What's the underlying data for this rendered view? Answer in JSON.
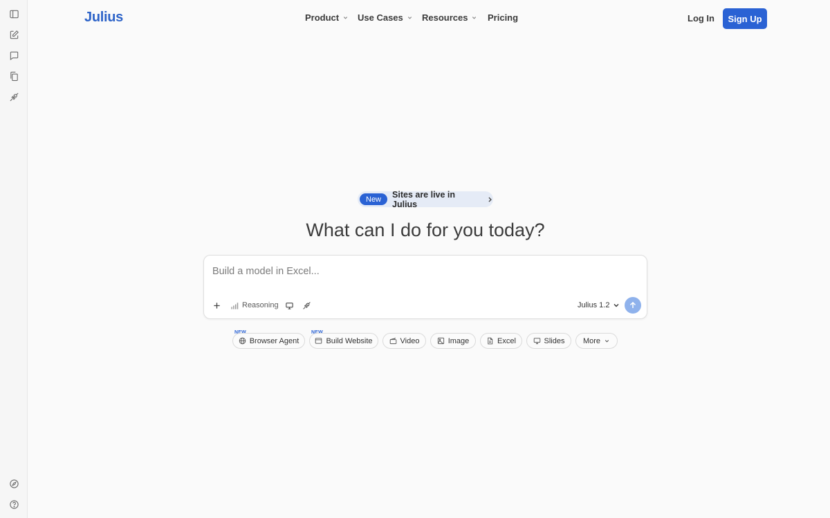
{
  "brand": {
    "logo": "Julius",
    "color": "#2d63c8"
  },
  "sidebar": {
    "top_icons": [
      "sidebar-toggle-icon",
      "new-chat-icon",
      "chat-icon",
      "files-icon",
      "connectors-icon"
    ],
    "bottom_icons": [
      "compass-icon",
      "help-icon"
    ]
  },
  "nav": {
    "items": [
      {
        "label": "Product",
        "has_menu": true
      },
      {
        "label": "Use Cases",
        "has_menu": true
      },
      {
        "label": "Resources",
        "has_menu": true
      },
      {
        "label": "Pricing",
        "has_menu": false
      }
    ],
    "login": "Log In",
    "signup": "Sign Up",
    "accent": "#2a62d4"
  },
  "announcement": {
    "badge": "New",
    "text": "Sites are live in Julius"
  },
  "headline": "What can I do for you today?",
  "composer": {
    "placeholder": "Build a model in Excel...",
    "value": "",
    "tools": {
      "reasoning": "Reasoning"
    },
    "model": "Julius 1.2"
  },
  "chips": [
    {
      "label": "Browser Agent",
      "icon": "globe-icon",
      "tag": "NEW"
    },
    {
      "label": "Build Website",
      "icon": "browser-window-icon",
      "tag": "NEW"
    },
    {
      "label": "Video",
      "icon": "clapperboard-icon",
      "tag": ""
    },
    {
      "label": "Image",
      "icon": "image-icon",
      "tag": ""
    },
    {
      "label": "Excel",
      "icon": "file-icon",
      "tag": ""
    },
    {
      "label": "Slides",
      "icon": "monitor-icon",
      "tag": ""
    },
    {
      "label": "More",
      "icon": "chevron-down-icon",
      "tag": ""
    }
  ]
}
